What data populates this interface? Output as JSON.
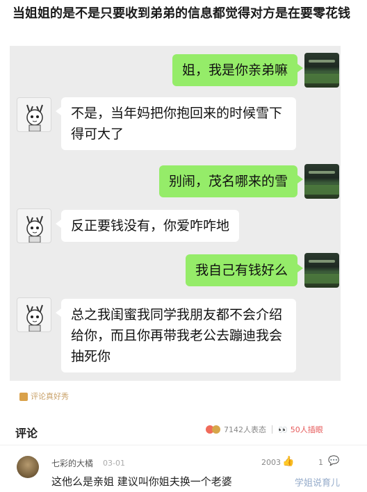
{
  "post": {
    "title": "当姐姐的是不是只要收到弟弟的信息都觉得对方是在要零花钱"
  },
  "chat": {
    "messages": [
      {
        "side": "right",
        "text": "姐，我是你亲弟嘛"
      },
      {
        "side": "left",
        "text": "不是，当年妈把你抱回来的时候雪下得可大了"
      },
      {
        "side": "right",
        "text": "别闹，茂名哪来的雪"
      },
      {
        "side": "left",
        "text": "反正要钱没有，你爱咋咋地"
      },
      {
        "side": "right",
        "text": "我自己有钱好么"
      },
      {
        "side": "left",
        "text": "总之我闺蜜我同学我朋友都不会介绍给你，而且你再带我老公去蹦迪我会抽死你"
      }
    ]
  },
  "meme_bar": {
    "label": "评论真好秀"
  },
  "comments": {
    "header": "评论",
    "reaction_count": "7142人表态",
    "watching": "50人插眼",
    "items": [
      {
        "user": "七彩的大橘",
        "date": "03-01",
        "likes": "2003",
        "replies": "1",
        "text": "这他么是亲姐 建议叫你姐夫换一个老婆"
      }
    ]
  },
  "watermark": "学姐说育儿"
}
